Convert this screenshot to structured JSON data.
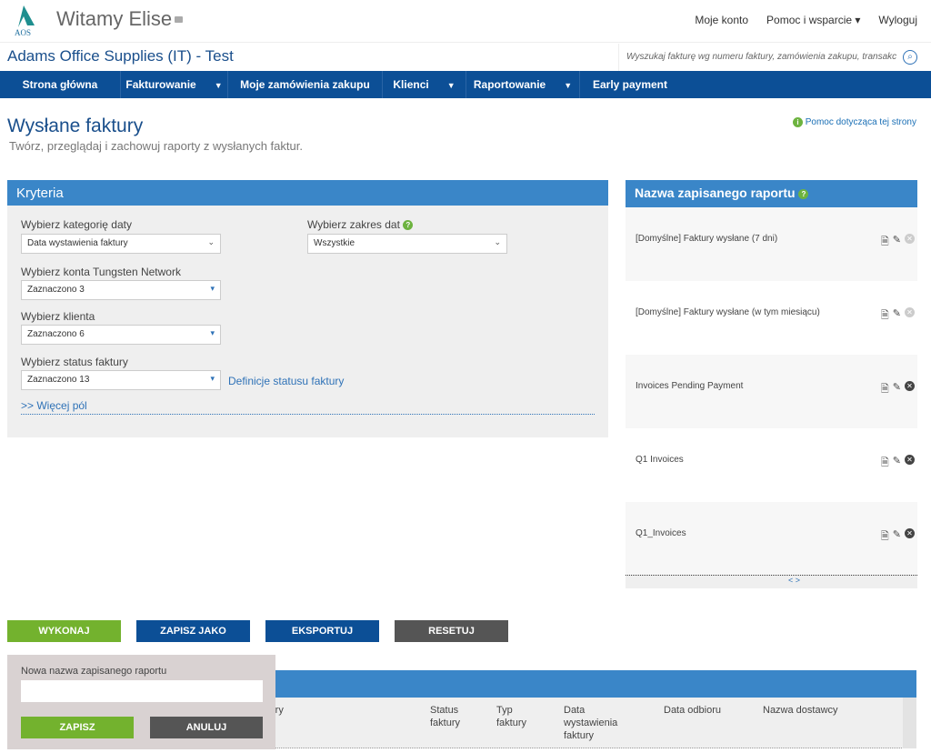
{
  "header": {
    "logo_text": "AOS",
    "welcome": "Witamy Elise",
    "links": [
      "Moje konto",
      "Pomoc i wsparcie",
      "Wyloguj"
    ],
    "company": "Adams Office Supplies (IT) - Test",
    "search_placeholder": "Wyszukaj fakturę wg numeru faktury, zamówienia zakupu, transakc"
  },
  "nav": [
    {
      "label": "Strona główna"
    },
    {
      "label": "Fakturowanie",
      "caret": "▼"
    },
    {
      "label": "Moje zamówienia zakupu"
    },
    {
      "label": "Klienci",
      "caret": "▼"
    },
    {
      "label": "Raportowanie",
      "caret": "▼"
    },
    {
      "label": "Early payment"
    }
  ],
  "page": {
    "title": "Wysłane faktury",
    "subtitle": "Twórz, przeglądaj i zachowuj raporty z wysłanych faktur.",
    "help": "Pomoc dotycząca tej strony"
  },
  "criteria": {
    "title": "Kryteria",
    "date_category_label": "Wybierz kategorię daty",
    "date_category_value": "Data wystawienia faktury",
    "date_range_label": "Wybierz zakres dat",
    "date_range_value": "Wszystkie",
    "accounts_label": "Wybierz konta Tungsten Network",
    "accounts_value": "Zaznaczono 3",
    "customer_label": "Wybierz klienta",
    "customer_value": "Zaznaczono 6",
    "status_label": "Wybierz status faktury",
    "status_value": "Zaznaczono 13",
    "status_def_link": "Definicje statusu faktury",
    "more_fields": ">> Więcej pól"
  },
  "saved": {
    "title": "Nazwa zapisanego raportu",
    "reports": [
      "[Domyślne] Faktury wysłane (7 dni)",
      "[Domyślne] Faktury wysłane (w tym miesiącu)",
      "Invoices Pending Payment",
      "Q1 Invoices",
      "Q1_Invoices"
    ],
    "pager": "< >"
  },
  "buttons": {
    "run": "WYKONAJ",
    "save_as": "ZAPISZ JAKO",
    "export": "EKSPORTUJ",
    "reset": "RESETUJ"
  },
  "colors": {
    "run": "#73b22e",
    "primary": "#0c4f96",
    "reset": "#555555"
  },
  "table": {
    "headers": [
      "ktury",
      "Status faktury",
      "Typ faktury",
      "Data wystawienia faktury",
      "Data odbioru",
      "Nazwa dostawcy"
    ]
  },
  "popup": {
    "label": "Nowa nazwa zapisanego raportu",
    "value": "",
    "save": "ZAPISZ",
    "cancel": "ANULUJ"
  }
}
